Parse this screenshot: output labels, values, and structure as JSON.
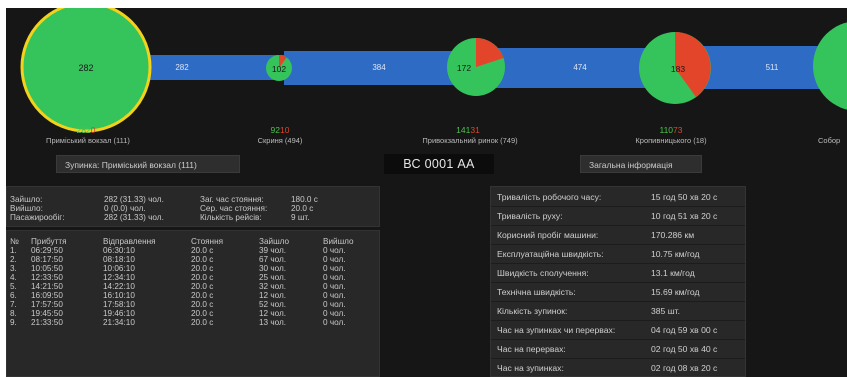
{
  "route": {
    "stops": [
      {
        "name": "Приміський вокзал (111)",
        "value": "282",
        "passengers_in": "282",
        "passengers_out": "0",
        "out_fraction": 0
      },
      {
        "name": "Скриня (494)",
        "value": "102",
        "passengers_in": "92",
        "passengers_out": "10",
        "out_fraction": 0.1
      },
      {
        "name": "Привокзальний ринок (749)",
        "value": "172",
        "passengers_in": "141",
        "passengers_out": "31",
        "out_fraction": 0.18
      },
      {
        "name": "Кропивницького (18)",
        "value": "183",
        "passengers_in": "110",
        "passengers_out": "73",
        "out_fraction": 0.4
      },
      {
        "name": "Собор",
        "value": "",
        "passengers_in": "",
        "passengers_out": "",
        "out_fraction": 0
      }
    ],
    "segments": [
      "282",
      "384",
      "474",
      "511"
    ]
  },
  "stop_panel": {
    "title": "Зупинка: Приміський вокзал (111)",
    "summary": {
      "labels": [
        "Зайшло:",
        "Вийшло:",
        "Пасажирообіг:"
      ],
      "values": [
        "282 (31.33) чол.",
        "0 (0.0) чол.",
        "282 (31.33) чол."
      ],
      "labels2": [
        "Заг. час стояння:",
        "Сер. час стояння:",
        "Кількість рейсів:"
      ],
      "values2": [
        "180.0 с",
        "20.0 с",
        "9 шт."
      ]
    },
    "table": {
      "headers": [
        "№",
        "Прибуття",
        "Відправлення",
        "Стояння",
        "Зайшло",
        "Вийшло"
      ],
      "rows": [
        [
          "1.",
          "06:29:50",
          "06:30:10",
          "20.0 с",
          "39 чол.",
          "0 чол."
        ],
        [
          "2.",
          "08:17:50",
          "08:18:10",
          "20.0 с",
          "67 чол.",
          "0 чол."
        ],
        [
          "3.",
          "10:05:50",
          "10:06:10",
          "20.0 с",
          "30 чол.",
          "0 чол."
        ],
        [
          "4.",
          "12:33:50",
          "12:34:10",
          "20.0 с",
          "25 чол.",
          "0 чол."
        ],
        [
          "5.",
          "14:21:50",
          "14:22:10",
          "20.0 с",
          "32 чол.",
          "0 чол."
        ],
        [
          "6.",
          "16:09:50",
          "16:10:10",
          "20.0 с",
          "12 чол.",
          "0 чол."
        ],
        [
          "7.",
          "17:57:50",
          "17:58:10",
          "20.0 с",
          "52 чол.",
          "0 чол."
        ],
        [
          "8.",
          "19:45:50",
          "19:46:10",
          "20.0 с",
          "12 чол.",
          "0 чол."
        ],
        [
          "9.",
          "21:33:50",
          "21:34:10",
          "20.0 с",
          "13 чол.",
          "0 чол."
        ]
      ]
    }
  },
  "vehicle": {
    "plate": "ВС 0001 АА"
  },
  "general": {
    "title": "Загальна інформація",
    "rows": [
      {
        "label": "Тривалість робочого часу:",
        "value": "15 год 50 хв 20 с"
      },
      {
        "label": "Тривалість руху:",
        "value": "10 год 51 хв 20 с"
      },
      {
        "label": "Корисний пробіг машини:",
        "value": "170.286 км"
      },
      {
        "label": "Експлуатаційна швидкість:",
        "value": "10.75 км/год"
      },
      {
        "label": "Швидкість сполучення:",
        "value": "13.1 км/год"
      },
      {
        "label": "Технічна швидкість:",
        "value": "15.69 км/год"
      },
      {
        "label": "Кількість зупинок:",
        "value": "385 шт."
      },
      {
        "label": "Час на зупинках чи перервах:",
        "value": "04 год 59 хв 00 с"
      },
      {
        "label": "Час на перервах:",
        "value": "02 год 50 хв 40 с"
      },
      {
        "label": "Час на зупинках:",
        "value": "02 год 08 хв 20 с"
      }
    ]
  },
  "colors": {
    "bar": "#2d6bc4",
    "pie_in": "#35c35c",
    "pie_out": "#e2452a",
    "selected_ring": "#f2d21a",
    "bg": "#161616"
  }
}
